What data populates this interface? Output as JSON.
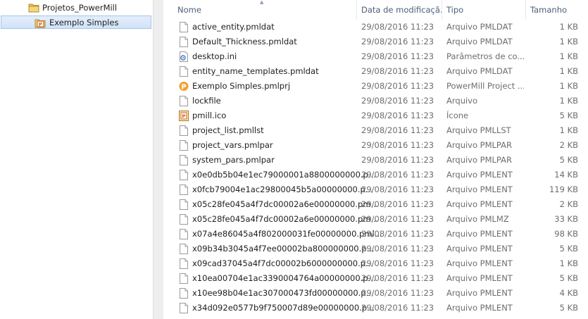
{
  "nav": {
    "items": [
      {
        "label": "Projetos_PowerMill",
        "icon": "folder-icon"
      },
      {
        "label": "Exemplo Simples",
        "icon": "powermill-project-icon"
      }
    ]
  },
  "columns": {
    "name": "Nome",
    "date": "Data de modificaçã...",
    "type": "Tipo",
    "size": "Tamanho"
  },
  "files": [
    {
      "name": "active_entity.pmldat",
      "date": "29/08/2016 11:23",
      "type": "Arquivo PMLDAT",
      "size": "1 KB",
      "icon": "document-icon"
    },
    {
      "name": "Default_Thickness.pmldat",
      "date": "29/08/2016 11:23",
      "type": "Arquivo PMLDAT",
      "size": "1 KB",
      "icon": "document-icon"
    },
    {
      "name": "desktop.ini",
      "date": "29/08/2016 11:23",
      "type": "Parâmetros de co...",
      "size": "1 KB",
      "icon": "settings-file-icon"
    },
    {
      "name": "entity_name_templates.pmldat",
      "date": "29/08/2016 11:23",
      "type": "Arquivo PMLDAT",
      "size": "1 KB",
      "icon": "document-icon"
    },
    {
      "name": "Exemplo Simples.pmlprj",
      "date": "29/08/2016 11:23",
      "type": "PowerMill Project ...",
      "size": "1 KB",
      "icon": "powermill-logo-icon"
    },
    {
      "name": "lockfile",
      "date": "29/08/2016 11:23",
      "type": "Arquivo",
      "size": "1 KB",
      "icon": "document-icon"
    },
    {
      "name": "pmill.ico",
      "date": "29/08/2016 11:23",
      "type": "Ícone",
      "size": "5 KB",
      "icon": "image-icon"
    },
    {
      "name": "project_list.pmllst",
      "date": "29/08/2016 11:23",
      "type": "Arquivo PMLLST",
      "size": "1 KB",
      "icon": "document-icon"
    },
    {
      "name": "project_vars.pmlpar",
      "date": "29/08/2016 11:23",
      "type": "Arquivo PMLPAR",
      "size": "2 KB",
      "icon": "document-icon"
    },
    {
      "name": "system_pars.pmlpar",
      "date": "29/08/2016 11:23",
      "type": "Arquivo PMLPAR",
      "size": "5 KB",
      "icon": "document-icon"
    },
    {
      "name": "x0e0db5b04e1ec79000001a8800000000.p...",
      "date": "29/08/2016 11:23",
      "type": "Arquivo PMLENT",
      "size": "14 KB",
      "icon": "document-icon"
    },
    {
      "name": "x0fcb79004e1ac29800045b5a00000000.p...",
      "date": "29/08/2016 11:23",
      "type": "Arquivo PMLENT",
      "size": "119 KB",
      "icon": "document-icon"
    },
    {
      "name": "x05c28fe045a4f7dc00002a6e00000000.pm...",
      "date": "29/08/2016 11:23",
      "type": "Arquivo PMLENT",
      "size": "2 KB",
      "icon": "document-icon"
    },
    {
      "name": "x05c28fe045a4f7dc00002a6e00000000.pm...",
      "date": "29/08/2016 11:23",
      "type": "Arquivo PMLMZ",
      "size": "33 KB",
      "icon": "document-icon"
    },
    {
      "name": "x07a4e86045a4f802000031fe00000000.pml...",
      "date": "29/08/2016 11:23",
      "type": "Arquivo PMLENT",
      "size": "98 KB",
      "icon": "document-icon"
    },
    {
      "name": "x09b34b3045a4f7ee00002ba800000000.p...",
      "date": "29/08/2016 11:23",
      "type": "Arquivo PMLENT",
      "size": "5 KB",
      "icon": "document-icon"
    },
    {
      "name": "x09cad37045a4f7dc00002b6000000000.p...",
      "date": "29/08/2016 11:23",
      "type": "Arquivo PMLENT",
      "size": "1 KB",
      "icon": "document-icon"
    },
    {
      "name": "x10ea00704e1ac3390004764a00000000.p...",
      "date": "29/08/2016 11:23",
      "type": "Arquivo PMLENT",
      "size": "5 KB",
      "icon": "document-icon"
    },
    {
      "name": "x10ee98b04e1ac307000473fd00000000.p...",
      "date": "29/08/2016 11:23",
      "type": "Arquivo PMLENT",
      "size": "4 KB",
      "icon": "document-icon"
    },
    {
      "name": "x34d092e0577b9f750007d89e00000000.p...",
      "date": "29/08/2016 11:23",
      "type": "Arquivo PMLENT",
      "size": "5 KB",
      "icon": "document-icon"
    }
  ]
}
